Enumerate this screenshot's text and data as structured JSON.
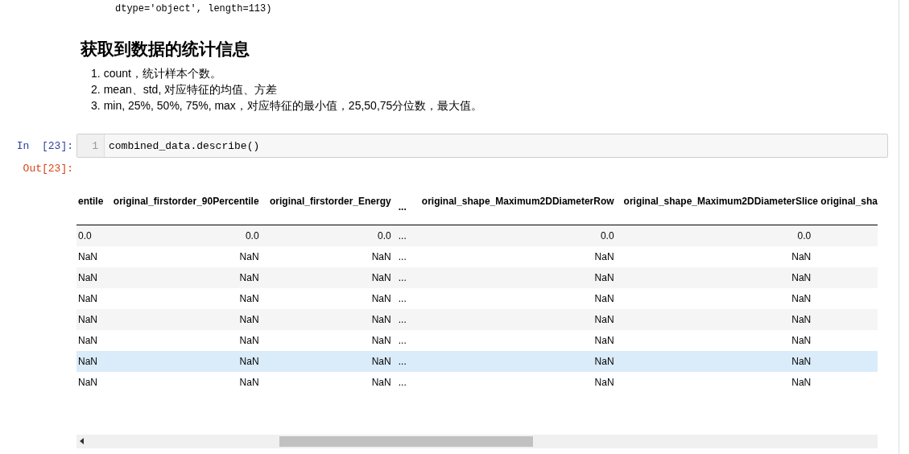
{
  "prev_output": "dtype='object', length=113)",
  "heading": "获取到数据的统计信息",
  "list": [
    {
      "marker": "1.",
      "text": "count，统计样本个数。"
    },
    {
      "marker": "2.",
      "text": "mean、std, 对应特征的均值、方差"
    },
    {
      "marker": "3.",
      "text": "min, 25%, 50%, 75%, max，对应特征的最小值，25,50,75分位数，最大值。"
    }
  ],
  "code_cell": {
    "prompt": "In  [23]:",
    "line_number": "1",
    "code": "combined_data.describe()"
  },
  "output": {
    "prompt": "Out[23]:",
    "table": {
      "columns": [
        "entile",
        "original_firstorder_90Percentile",
        "original_firstorder_Energy",
        "...",
        "original_shape_Maximum2DDiameterRow",
        "original_shape_Maximum2DDiameterSlice",
        "original_sha"
      ],
      "rows": [
        {
          "highlighted": false,
          "cells": [
            "0.0",
            "0.0",
            "0.0",
            "...",
            "0.0",
            "0.0"
          ]
        },
        {
          "highlighted": false,
          "cells": [
            "NaN",
            "NaN",
            "NaN",
            "...",
            "NaN",
            "NaN"
          ]
        },
        {
          "highlighted": false,
          "cells": [
            "NaN",
            "NaN",
            "NaN",
            "...",
            "NaN",
            "NaN"
          ]
        },
        {
          "highlighted": false,
          "cells": [
            "NaN",
            "NaN",
            "NaN",
            "...",
            "NaN",
            "NaN"
          ]
        },
        {
          "highlighted": false,
          "cells": [
            "NaN",
            "NaN",
            "NaN",
            "...",
            "NaN",
            "NaN"
          ]
        },
        {
          "highlighted": false,
          "cells": [
            "NaN",
            "NaN",
            "NaN",
            "...",
            "NaN",
            "NaN"
          ]
        },
        {
          "highlighted": true,
          "cells": [
            "NaN",
            "NaN",
            "NaN",
            "...",
            "NaN",
            "NaN"
          ]
        },
        {
          "highlighted": false,
          "cells": [
            "NaN",
            "NaN",
            "NaN",
            "...",
            "NaN",
            "NaN"
          ]
        }
      ]
    }
  }
}
